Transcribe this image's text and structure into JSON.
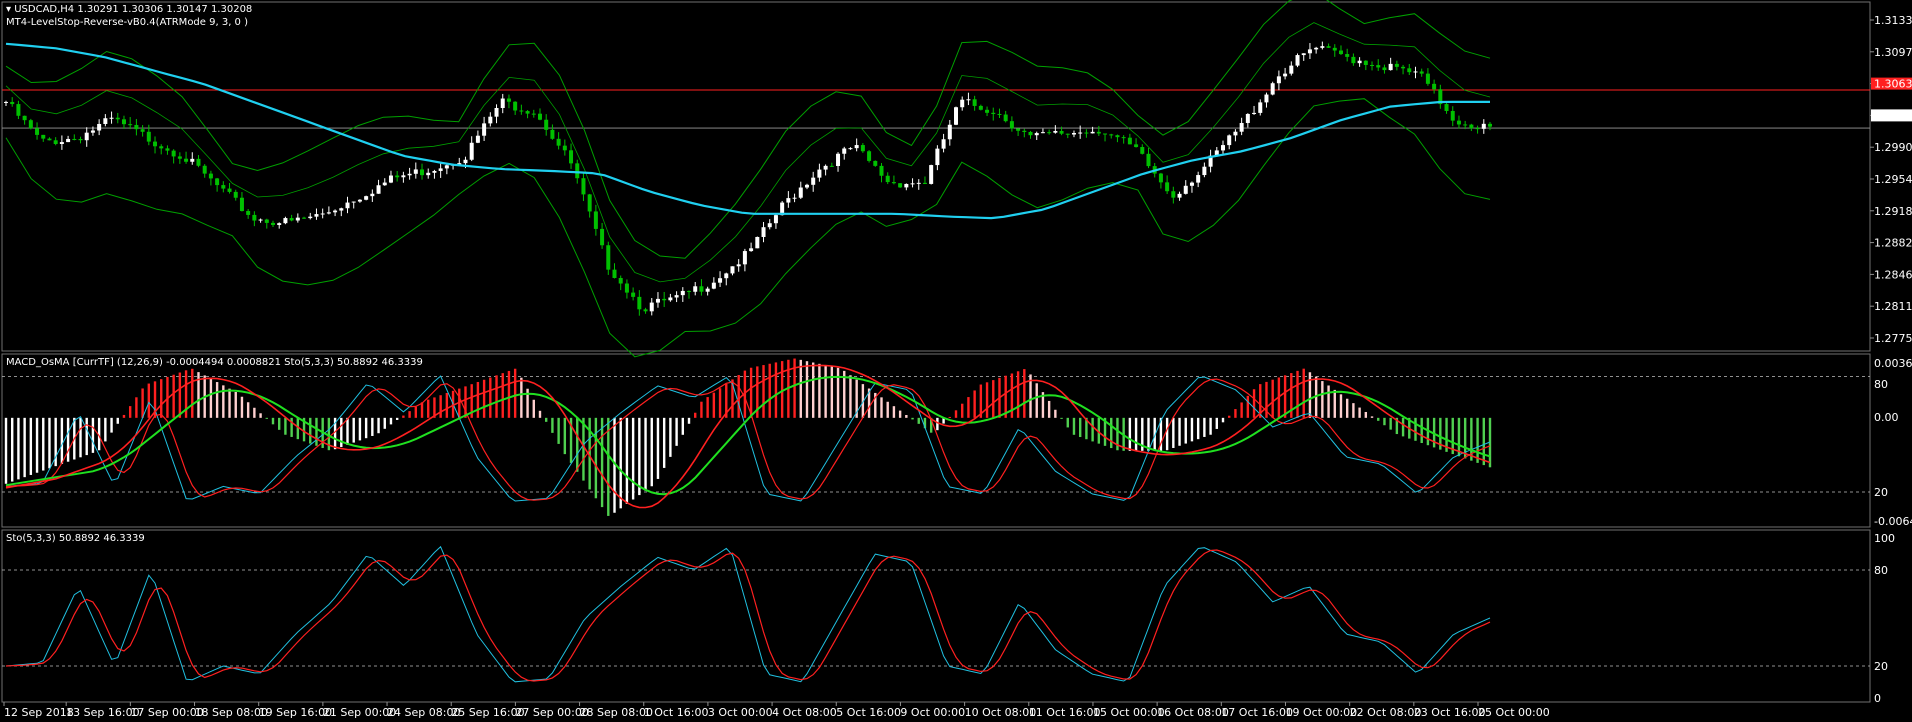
{
  "window": {
    "symbol_title": "USDCAD,H4  1.30291 1.30306 1.30147 1.30208",
    "indicator_title": "MT4-LevelStop-Reverse-vB0.4(ATRMode 9, 3, 0 )",
    "panel2_title": "MACD_OsMA [CurrTF] (12,26,9) -0.0004494 0.0008821  Sto(5,3,3) 50.8892 46.3339",
    "panel3_title": "Sto(5,3,3) 50.8892 46.3339"
  },
  "colors": {
    "background": "#000000",
    "bull_candle": "#ffffff",
    "bear_candle": "#00c000",
    "ma": "#20d0f0",
    "bands": "#00a000",
    "level_line": "#ff2020",
    "hist_up": "#ff2020",
    "hist_up_fade": "#ffd0d0",
    "hist_down": "#50d050",
    "hist_down_fade": "#ffffff",
    "sto_main": "#20c0e0",
    "sto_signal": "#ff2020",
    "macd_sig_green": "#20e020"
  },
  "price_axis": {
    "labels": [
      "1.31330",
      "1.30970",
      "1.30634",
      "1.30208",
      "1.29900",
      "1.29540",
      "1.29180",
      "1.28820",
      "1.28460",
      "1.28110",
      "1.27750"
    ],
    "red_level": "1.30634",
    "current": "1.30208"
  },
  "macd_axis": {
    "labels": [
      "0.003633",
      "80",
      "0.00",
      "20",
      "-0.006444"
    ]
  },
  "sto_axis": {
    "labels": [
      "100",
      "80",
      "20",
      "0"
    ]
  },
  "time_axis": {
    "labels": [
      "12 Sep 2018",
      "13 Sep 16:00",
      "17 Sep 00:00",
      "18 Sep 08:00",
      "19 Sep 16:00",
      "21 Sep 00:00",
      "24 Sep 08:00",
      "25 Sep 16:00",
      "27 Sep 00:00",
      "28 Sep 08:00",
      "1 Oct 16:00",
      "3 Oct 00:00",
      "4 Oct 08:00",
      "5 Oct 16:00",
      "9 Oct 00:00",
      "10 Oct 08:00",
      "11 Oct 16:00",
      "15 Oct 00:00",
      "16 Oct 08:00",
      "17 Oct 16:00",
      "19 Oct 00:00",
      "22 Oct 08:00",
      "23 Oct 16:00",
      "25 Oct 00:00"
    ]
  },
  "chart_data": {
    "type": "line",
    "title": "USDCAD,H4",
    "price_range": [
      1.2775,
      1.3155
    ],
    "x_labels": [
      "12 Sep 2018",
      "13 Sep 16:00",
      "17 Sep 00:00",
      "18 Sep 08:00",
      "19 Sep 16:00",
      "21 Sep 00:00",
      "24 Sep 08:00",
      "25 Sep 16:00",
      "27 Sep 00:00",
      "28 Sep 08:00",
      "1 Oct 16:00",
      "3 Oct 00:00",
      "4 Oct 08:00",
      "5 Oct 16:00",
      "9 Oct 00:00",
      "10 Oct 08:00",
      "11 Oct 16:00",
      "15 Oct 00:00",
      "16 Oct 08:00",
      "17 Oct 16:00",
      "19 Oct 00:00",
      "22 Oct 08:00",
      "23 Oct 16:00",
      "25 Oct 00:00"
    ],
    "price_close": [
      1.305,
      1.3005,
      1.301,
      1.303,
      1.301,
      1.299,
      1.2955,
      1.292,
      1.2915,
      1.2925,
      1.2945,
      1.2965,
      1.2975,
      1.299,
      1.305,
      1.304,
      1.298,
      1.287,
      1.282,
      1.283,
      1.285,
      1.288,
      1.2935,
      1.2975,
      1.3,
      1.296,
      1.296,
      1.305,
      1.304,
      1.301,
      1.3015,
      1.302,
      1.2995,
      1.2945,
      1.298,
      1.3025,
      1.308,
      1.311,
      1.31,
      1.309,
      1.308,
      1.303,
      1.302
    ],
    "ma_values": [
      1.3115,
      1.311,
      1.31,
      1.3085,
      1.307,
      1.305,
      1.303,
      1.301,
      1.299,
      1.298,
      1.2975,
      1.2973,
      1.297,
      1.295,
      1.2935,
      1.2925,
      1.2925,
      1.2925,
      1.2925,
      1.2922,
      1.292,
      1.293,
      1.295,
      1.297,
      1.2985,
      1.2995,
      1.301,
      1.303,
      1.3045,
      1.305,
      1.305
    ],
    "series": [
      {
        "name": "MACD_OsMA",
        "values": [
          -0.004,
          -0.003,
          -0.002,
          0.002,
          0.003,
          0.0015,
          -0.001,
          -0.002,
          -0.001,
          0.001,
          0.002,
          0.003,
          -0.002,
          -0.006,
          -0.004,
          0.001,
          0.003,
          0.0036,
          0.003,
          0.001,
          -0.001,
          0.002,
          0.003,
          -0.001,
          -0.002,
          -0.002,
          -0.001,
          0.002,
          0.003,
          0.001,
          -0.001,
          -0.002,
          -0.003
        ]
      },
      {
        "name": "Sto(5,3,3)",
        "values": [
          20,
          22,
          70,
          20,
          80,
          10,
          20,
          15,
          40,
          60,
          90,
          70,
          95,
          40,
          10,
          12,
          50,
          70,
          88,
          80,
          95,
          15,
          10,
          50,
          90,
          85,
          20,
          15,
          60,
          30,
          15,
          10,
          70,
          95,
          85,
          60,
          70,
          40,
          35,
          15,
          40,
          50
        ]
      }
    ],
    "sto_levels": [
      80,
      20
    ],
    "grid": false
  }
}
